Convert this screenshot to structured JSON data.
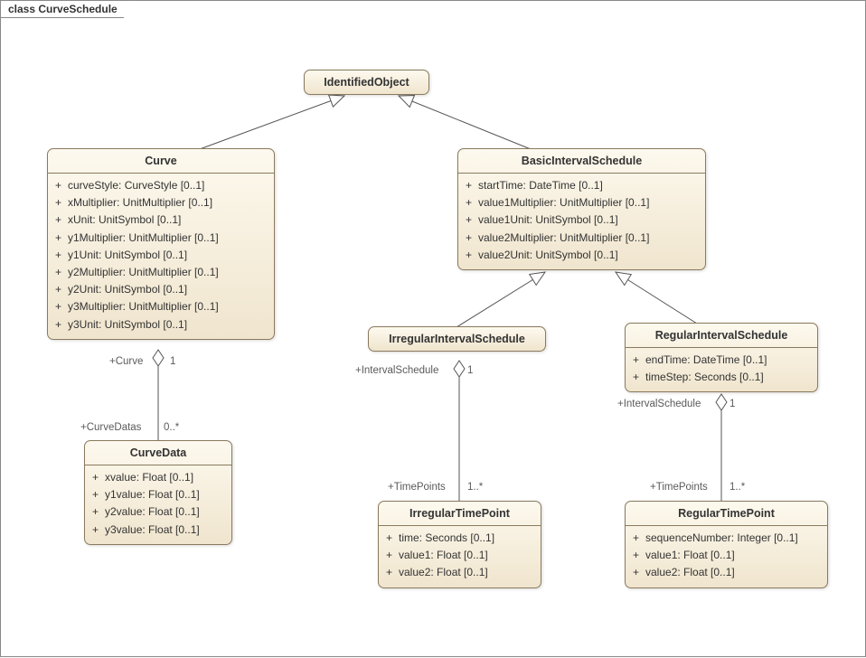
{
  "frame_title": "class CurveSchedule",
  "classes": {
    "IdentifiedObject": {
      "title": "IdentifiedObject",
      "attrs": []
    },
    "Curve": {
      "title": "Curve",
      "attrs": [
        "curveStyle: CurveStyle [0..1]",
        "xMultiplier: UnitMultiplier [0..1]",
        "xUnit: UnitSymbol [0..1]",
        "y1Multiplier: UnitMultiplier [0..1]",
        "y1Unit: UnitSymbol [0..1]",
        "y2Multiplier: UnitMultiplier [0..1]",
        "y2Unit: UnitSymbol [0..1]",
        "y3Multiplier: UnitMultiplier [0..1]",
        "y3Unit: UnitSymbol [0..1]"
      ]
    },
    "BasicIntervalSchedule": {
      "title": "BasicIntervalSchedule",
      "attrs": [
        "startTime: DateTime [0..1]",
        "value1Multiplier: UnitMultiplier [0..1]",
        "value1Unit: UnitSymbol [0..1]",
        "value2Multiplier: UnitMultiplier [0..1]",
        "value2Unit: UnitSymbol [0..1]"
      ]
    },
    "IrregularIntervalSchedule": {
      "title": "IrregularIntervalSchedule",
      "attrs": []
    },
    "RegularIntervalSchedule": {
      "title": "RegularIntervalSchedule",
      "attrs": [
        "endTime: DateTime [0..1]",
        "timeStep: Seconds [0..1]"
      ]
    },
    "CurveData": {
      "title": "CurveData",
      "attrs": [
        "xvalue: Float [0..1]",
        "y1value: Float [0..1]",
        "y2value: Float [0..1]",
        "y3value: Float [0..1]"
      ]
    },
    "IrregularTimePoint": {
      "title": "IrregularTimePoint",
      "attrs": [
        "time: Seconds [0..1]",
        "value1: Float [0..1]",
        "value2: Float [0..1]"
      ]
    },
    "RegularTimePoint": {
      "title": "RegularTimePoint",
      "attrs": [
        "sequenceNumber: Integer [0..1]",
        "value1: Float [0..1]",
        "value2: Float [0..1]"
      ]
    }
  },
  "labels": {
    "curve_role": "+Curve",
    "curve_card": "1",
    "curvedatas_role": "+CurveDatas",
    "curvedatas_card": "0..*",
    "irr_sched_role": "+IntervalSchedule",
    "irr_sched_card": "1",
    "irr_tp_role": "+TimePoints",
    "irr_tp_card": "1..*",
    "reg_sched_role": "+IntervalSchedule",
    "reg_sched_card": "1",
    "reg_tp_role": "+TimePoints",
    "reg_tp_card": "1..*"
  },
  "chart_data": {
    "type": "uml-class-diagram",
    "classes": [
      {
        "name": "IdentifiedObject",
        "attributes": []
      },
      {
        "name": "Curve",
        "attributes": [
          "curveStyle: CurveStyle [0..1]",
          "xMultiplier: UnitMultiplier [0..1]",
          "xUnit: UnitSymbol [0..1]",
          "y1Multiplier: UnitMultiplier [0..1]",
          "y1Unit: UnitSymbol [0..1]",
          "y2Multiplier: UnitMultiplier [0..1]",
          "y2Unit: UnitSymbol [0..1]",
          "y3Multiplier: UnitMultiplier [0..1]",
          "y3Unit: UnitSymbol [0..1]"
        ]
      },
      {
        "name": "BasicIntervalSchedule",
        "attributes": [
          "startTime: DateTime [0..1]",
          "value1Multiplier: UnitMultiplier [0..1]",
          "value1Unit: UnitSymbol [0..1]",
          "value2Multiplier: UnitMultiplier [0..1]",
          "value2Unit: UnitSymbol [0..1]"
        ]
      },
      {
        "name": "IrregularIntervalSchedule",
        "attributes": []
      },
      {
        "name": "RegularIntervalSchedule",
        "attributes": [
          "endTime: DateTime [0..1]",
          "timeStep: Seconds [0..1]"
        ]
      },
      {
        "name": "CurveData",
        "attributes": [
          "xvalue: Float [0..1]",
          "y1value: Float [0..1]",
          "y2value: Float [0..1]",
          "y3value: Float [0..1]"
        ]
      },
      {
        "name": "IrregularTimePoint",
        "attributes": [
          "time: Seconds [0..1]",
          "value1: Float [0..1]",
          "value2: Float [0..1]"
        ]
      },
      {
        "name": "RegularTimePoint",
        "attributes": [
          "sequenceNumber: Integer [0..1]",
          "value1: Float [0..1]",
          "value2: Float [0..1]"
        ]
      }
    ],
    "generalizations": [
      {
        "sub": "Curve",
        "super": "IdentifiedObject"
      },
      {
        "sub": "BasicIntervalSchedule",
        "super": "IdentifiedObject"
      },
      {
        "sub": "IrregularIntervalSchedule",
        "super": "BasicIntervalSchedule"
      },
      {
        "sub": "RegularIntervalSchedule",
        "super": "BasicIntervalSchedule"
      }
    ],
    "aggregations": [
      {
        "whole": "Curve",
        "whole_role": "+Curve",
        "whole_card": "1",
        "part": "CurveData",
        "part_role": "+CurveDatas",
        "part_card": "0..*"
      },
      {
        "whole": "IrregularIntervalSchedule",
        "whole_role": "+IntervalSchedule",
        "whole_card": "1",
        "part": "IrregularTimePoint",
        "part_role": "+TimePoints",
        "part_card": "1..*"
      },
      {
        "whole": "RegularIntervalSchedule",
        "whole_role": "+IntervalSchedule",
        "whole_card": "1",
        "part": "RegularTimePoint",
        "part_role": "+TimePoints",
        "part_card": "1..*"
      }
    ]
  }
}
